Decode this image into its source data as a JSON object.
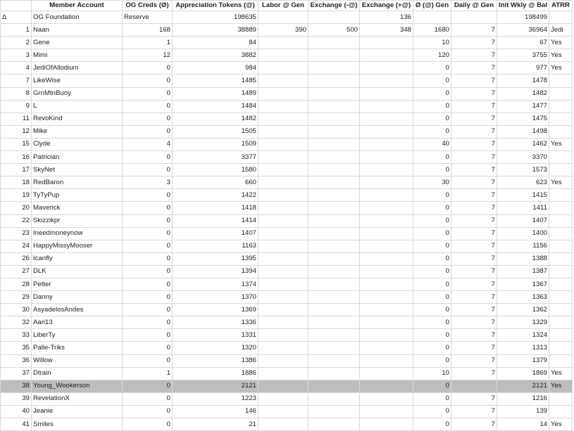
{
  "headers": [
    "",
    "Member Account",
    "OG Creds (Ø)",
    "Appreciation Tokens (@)",
    "Labor @ Gen",
    "Exchange (-@)",
    "Exchange (+@)",
    "Ø (@) Gen",
    "Daily @ Gen",
    "Init Wkly @ Bal",
    "ATRR"
  ],
  "rows": [
    [
      "Δ",
      "OG Foundation",
      "Reserve",
      "198635",
      "",
      "",
      "136",
      "",
      "",
      "198499",
      ""
    ],
    [
      "1",
      "Naan",
      "168",
      "38889",
      "390",
      "500",
      "348",
      "1680",
      "7",
      "36964",
      "Jedi"
    ],
    [
      "2",
      "Gene",
      "1",
      "84",
      "",
      "",
      "",
      "10",
      "7",
      "67",
      "Yes"
    ],
    [
      "3",
      "Mimi",
      "12",
      "3882",
      "",
      "",
      "",
      "120",
      "7",
      "3755",
      "Yes"
    ],
    [
      "4",
      "JediOfAllodium",
      "0",
      "984",
      "",
      "",
      "",
      "0",
      "7",
      "977",
      "Yes"
    ],
    [
      "7",
      "LikeWise",
      "0",
      "1485",
      "",
      "",
      "",
      "0",
      "7",
      "1478",
      ""
    ],
    [
      "8",
      "GrnMtnBuoy",
      "0",
      "1489",
      "",
      "",
      "",
      "0",
      "7",
      "1482",
      ""
    ],
    [
      "9",
      "L",
      "0",
      "1484",
      "",
      "",
      "",
      "0",
      "7",
      "1477",
      ""
    ],
    [
      "11",
      "RevoKind",
      "0",
      "1482",
      "",
      "",
      "",
      "0",
      "7",
      "1475",
      ""
    ],
    [
      "12",
      "Mike",
      "0",
      "1505",
      "",
      "",
      "",
      "0",
      "7",
      "1498",
      ""
    ],
    [
      "15",
      "Clyde",
      "4",
      "1509",
      "",
      "",
      "",
      "40",
      "7",
      "1462",
      "Yes"
    ],
    [
      "16",
      "Patrician",
      "0",
      "3377",
      "",
      "",
      "",
      "0",
      "7",
      "3370",
      ""
    ],
    [
      "17",
      "SkyNet",
      "0",
      "1580",
      "",
      "",
      "",
      "0",
      "7",
      "1573",
      ""
    ],
    [
      "18",
      "RedBaron",
      "3",
      "660",
      "",
      "",
      "",
      "30",
      "7",
      "623",
      "Yes"
    ],
    [
      "19",
      "TyTyPup",
      "0",
      "1422",
      "",
      "",
      "",
      "0",
      "7",
      "1415",
      ""
    ],
    [
      "20",
      "Maverick",
      "0",
      "1418",
      "",
      "",
      "",
      "0",
      "7",
      "1411",
      ""
    ],
    [
      "22",
      "Skizzikpr",
      "0",
      "1414",
      "",
      "",
      "",
      "0",
      "7",
      "1407",
      ""
    ],
    [
      "23",
      "Ineedmoneynow",
      "0",
      "1407",
      "",
      "",
      "",
      "0",
      "7",
      "1400",
      ""
    ],
    [
      "24",
      "HappyMissyMooser",
      "0",
      "1163",
      "",
      "",
      "",
      "0",
      "7",
      "1156",
      ""
    ],
    [
      "26",
      "Icanfly",
      "0",
      "1395",
      "",
      "",
      "",
      "0",
      "7",
      "1388",
      ""
    ],
    [
      "27",
      "DLK",
      "0",
      "1394",
      "",
      "",
      "",
      "0",
      "7",
      "1387",
      ""
    ],
    [
      "28",
      "Petter",
      "0",
      "1374",
      "",
      "",
      "",
      "0",
      "7",
      "1367",
      ""
    ],
    [
      "29",
      "Danny",
      "0",
      "1370",
      "",
      "",
      "",
      "0",
      "7",
      "1363",
      ""
    ],
    [
      "30",
      "AsyadelosAndes",
      "0",
      "1369",
      "",
      "",
      "",
      "0",
      "7",
      "1362",
      ""
    ],
    [
      "32",
      "Aari13",
      "0",
      "1336",
      "",
      "",
      "",
      "0",
      "7",
      "1329",
      ""
    ],
    [
      "33",
      "LiberTy",
      "0",
      "1331",
      "",
      "",
      "",
      "0",
      "7",
      "1324",
      ""
    ],
    [
      "35",
      "Palle-Triks",
      "0",
      "1320",
      "",
      "",
      "",
      "0",
      "7",
      "1313",
      ""
    ],
    [
      "36",
      "Willow",
      "0",
      "1386",
      "",
      "",
      "",
      "0",
      "7",
      "1379",
      ""
    ],
    [
      "37",
      "Dtrain",
      "1",
      "1886",
      "",
      "",
      "",
      "10",
      "7",
      "1869",
      "Yes"
    ],
    [
      "38",
      "Young_Wookerson",
      "0",
      "2121",
      "",
      "",
      "",
      "0",
      "",
      "2121",
      "Yes"
    ],
    [
      "39",
      "RevelationX",
      "0",
      "1223",
      "",
      "",
      "",
      "0",
      "7",
      "1216",
      ""
    ],
    [
      "40",
      "Jeanie",
      "0",
      "146",
      "",
      "",
      "",
      "0",
      "7",
      "139",
      ""
    ],
    [
      "41",
      "Smiles",
      "0",
      "21",
      "",
      "",
      "",
      "0",
      "7",
      "14",
      "Yes"
    ]
  ],
  "highlight_row_index": 29
}
